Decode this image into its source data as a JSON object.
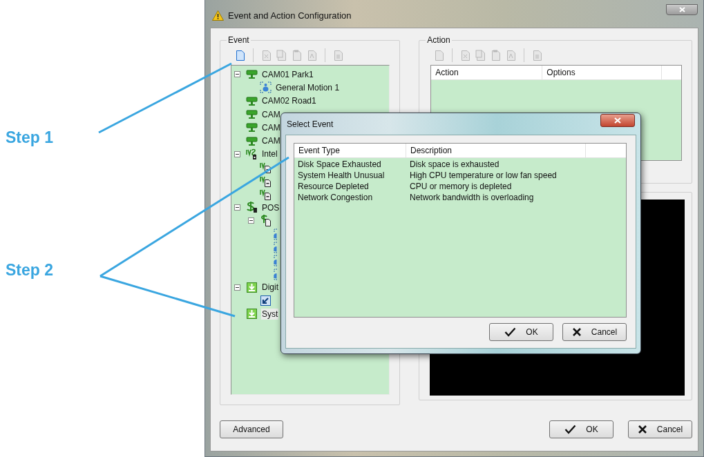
{
  "annotations": [
    {
      "text": "Step 1"
    },
    {
      "text": "Step 2"
    }
  ],
  "window": {
    "title": "Event and Action Configuration"
  },
  "event_panel": {
    "title": "Event",
    "toolbar": [
      {
        "kind": "new",
        "disabled": false
      },
      {
        "kind": "separator"
      },
      {
        "kind": "delete",
        "disabled": true
      },
      {
        "kind": "copy",
        "disabled": true
      },
      {
        "kind": "paste",
        "disabled": true
      },
      {
        "kind": "rename",
        "disabled": true
      },
      {
        "kind": "separator"
      },
      {
        "kind": "page",
        "disabled": true
      }
    ],
    "tree": [
      {
        "kind": "camera",
        "label": "CAM01 Park1",
        "expanded": true,
        "selected": false,
        "children": [
          {
            "kind": "motion",
            "label": "General Motion 1",
            "selected": false
          }
        ]
      },
      {
        "kind": "camera",
        "label": "CAM02 Road1",
        "selected": false
      },
      {
        "kind": "camera",
        "label": "CAM",
        "selected": false
      },
      {
        "kind": "camera",
        "label": "CAM",
        "selected": false
      },
      {
        "kind": "camera",
        "label": "CAM",
        "selected": false
      },
      {
        "kind": "analytics",
        "label": "Intel",
        "expanded": true,
        "selected": false,
        "children": [
          {
            "kind": "analytics-doc"
          },
          {
            "kind": "analytics-doc"
          },
          {
            "kind": "analytics-doc"
          }
        ]
      },
      {
        "kind": "pos",
        "label": "POS",
        "expanded": true,
        "selected": false,
        "children": [
          {
            "kind": "pos-doc",
            "expanded": true,
            "children": [
              {
                "kind": "motion-partial"
              },
              {
                "kind": "motion-partial"
              },
              {
                "kind": "motion-partial"
              },
              {
                "kind": "motion-partial"
              }
            ]
          }
        ]
      },
      {
        "kind": "digital",
        "label": "Digit",
        "expanded": true,
        "selected": false,
        "children": [
          {
            "kind": "arrow"
          }
        ]
      },
      {
        "kind": "digital",
        "label": "Syst",
        "selected": true
      }
    ]
  },
  "action_panel": {
    "title": "Action",
    "toolbar": [
      {
        "kind": "new",
        "disabled": true
      },
      {
        "kind": "separator"
      },
      {
        "kind": "delete",
        "disabled": true
      },
      {
        "kind": "copy",
        "disabled": true
      },
      {
        "kind": "paste",
        "disabled": true
      },
      {
        "kind": "rename",
        "disabled": true
      },
      {
        "kind": "separator"
      },
      {
        "kind": "page",
        "disabled": true
      }
    ],
    "columns": [
      "Action",
      "Options"
    ]
  },
  "left_buttons": [
    {
      "kind": "plain",
      "label": "Advanced"
    }
  ],
  "right_buttons": [
    {
      "kind": "ok",
      "label": "OK"
    },
    {
      "kind": "cancel",
      "label": "Cancel"
    }
  ],
  "dialog": {
    "title": "Select Event",
    "columns": [
      "Event Type",
      "Description"
    ],
    "rows": [
      {
        "cells": [
          "Disk Space Exhausted",
          "Disk space is exhausted"
        ]
      },
      {
        "cells": [
          "System Health Unusual",
          "High CPU temperature or low fan speed"
        ]
      },
      {
        "cells": [
          "Resource Depleted",
          "CPU or memory is depleted"
        ]
      },
      {
        "cells": [
          "Network Congestion",
          "Network bandwidth is overloading"
        ]
      }
    ],
    "buttons": [
      {
        "kind": "ok",
        "label": "OK"
      },
      {
        "kind": "cancel",
        "label": "Cancel"
      }
    ]
  }
}
